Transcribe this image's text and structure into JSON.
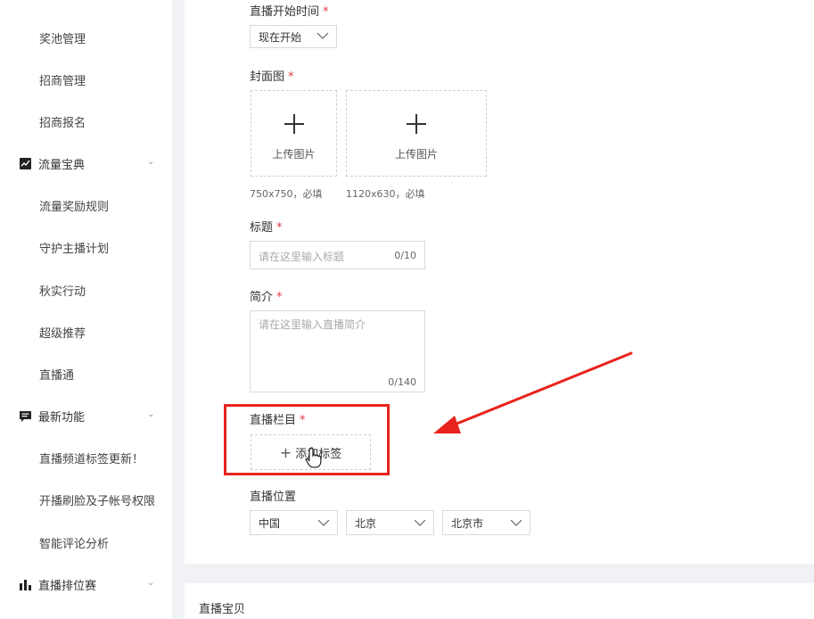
{
  "sidebar": {
    "items": [
      {
        "label": "奖池管理"
      },
      {
        "label": "招商管理"
      },
      {
        "label": "招商报名"
      },
      {
        "label": "流量奖励规则"
      },
      {
        "label": "守护主播计划"
      },
      {
        "label": "秋实行动"
      },
      {
        "label": "超级推荐"
      },
      {
        "label": "直播通"
      },
      {
        "label": "直播频道标签更新！"
      },
      {
        "label": "开播刷脸及子帐号权限"
      },
      {
        "label": "智能评论分析"
      }
    ],
    "groups": [
      {
        "label": "流量宝典",
        "icon": "trend-chart-icon"
      },
      {
        "label": "最新功能",
        "icon": "message-icon"
      },
      {
        "label": "直播排位赛",
        "icon": "bar-chart-icon"
      }
    ]
  },
  "form": {
    "start_time": {
      "label": "直播开始时间",
      "required_mark": "*",
      "value": "现在开始"
    },
    "cover": {
      "label": "封面图",
      "required_mark": "*",
      "upload_text_1": "上传图片",
      "upload_text_2": "上传图片",
      "hint_1": "750x750，必填",
      "hint_2": "1120x630，必填"
    },
    "title": {
      "label": "标题",
      "required_mark": "*",
      "placeholder": "请在这里输入标题",
      "count": "0/10"
    },
    "intro": {
      "label": "简介",
      "required_mark": "*",
      "placeholder": "请在这里输入直播简介",
      "count": "0/140"
    },
    "column": {
      "label": "直播栏目",
      "required_mark": "*",
      "add_tag_label": "添加标签"
    },
    "location": {
      "label": "直播位置",
      "country": "中国",
      "province": "北京",
      "city": "北京市"
    }
  },
  "bottom_section": {
    "title": "直播宝贝"
  },
  "colors": {
    "accent_red": "#e8231d",
    "required_red": "#e4393c"
  }
}
